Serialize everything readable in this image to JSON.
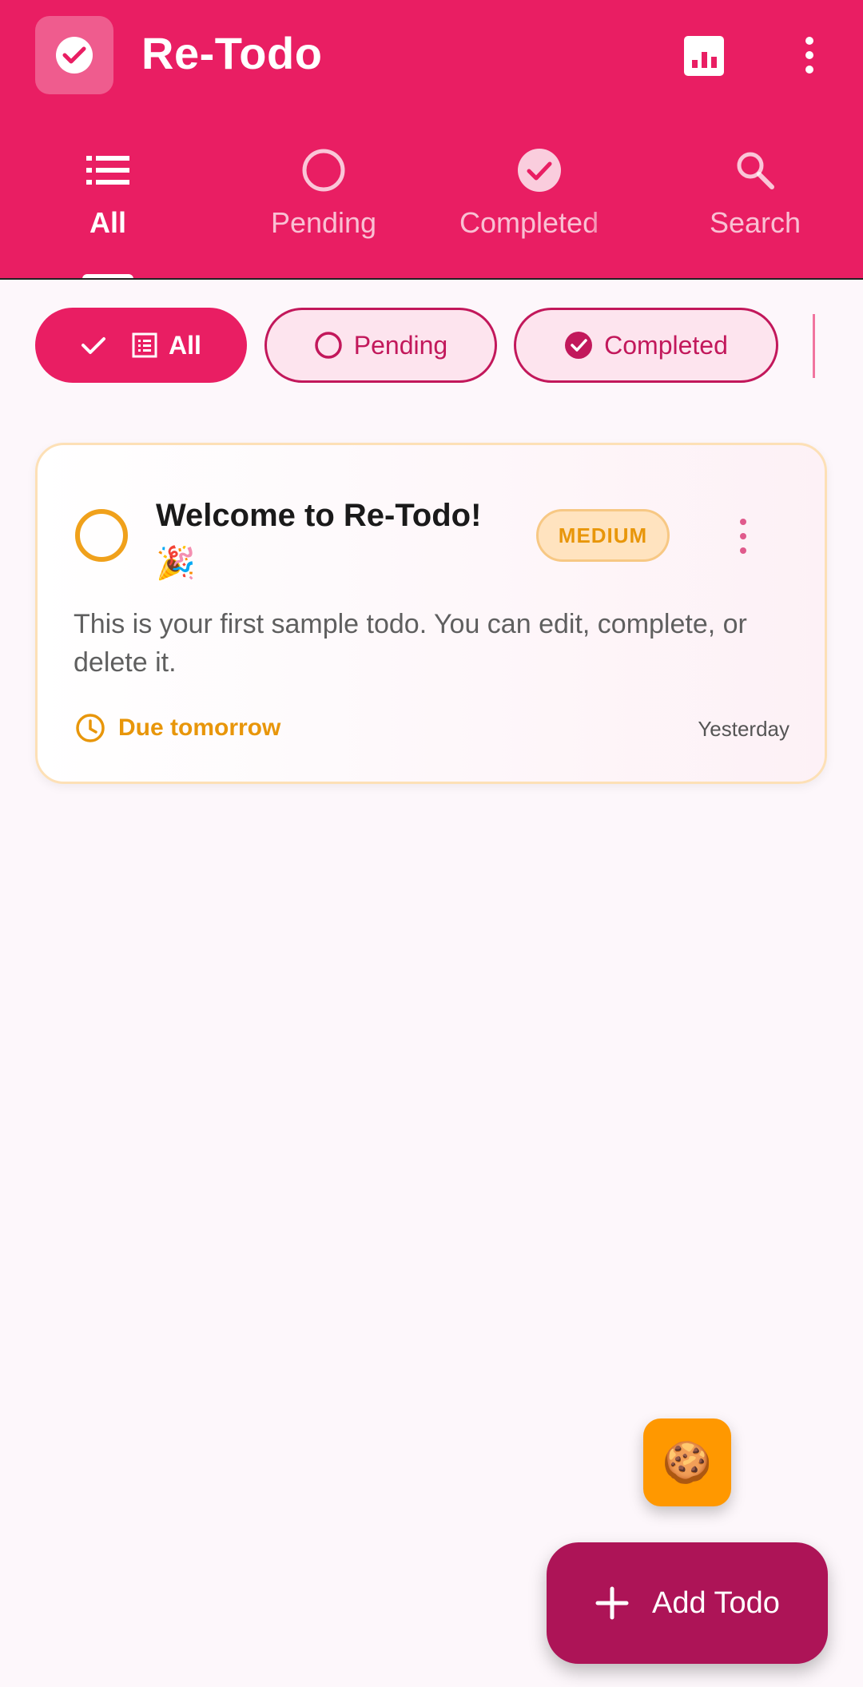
{
  "app": {
    "title": "Re-Todo"
  },
  "tabs": [
    {
      "label": "All",
      "icon": "list-icon",
      "active": true
    },
    {
      "label": "Pending",
      "icon": "circle-outline-icon",
      "active": false
    },
    {
      "label": "Completed",
      "icon": "check-circle-icon",
      "active": false
    },
    {
      "label": "Search",
      "icon": "search-icon",
      "active": false
    }
  ],
  "filters": [
    {
      "label": "All",
      "selected": true
    },
    {
      "label": "Pending",
      "selected": false
    },
    {
      "label": "Completed",
      "selected": false
    }
  ],
  "todos": [
    {
      "title": "Welcome to Re-Todo!",
      "emoji": "🎉",
      "priority": "MEDIUM",
      "description": "This is your first sample todo. You can edit, complete, or delete it.",
      "due": "Due tomorrow",
      "created": "Yesterday"
    }
  ],
  "fab": {
    "add_label": "Add Todo",
    "cookie_emoji": "🍪"
  },
  "colors": {
    "primary": "#e91e63",
    "fab": "#ad1457",
    "priority_medium": "#e8960a",
    "cookie_fab": "#ff9800"
  }
}
